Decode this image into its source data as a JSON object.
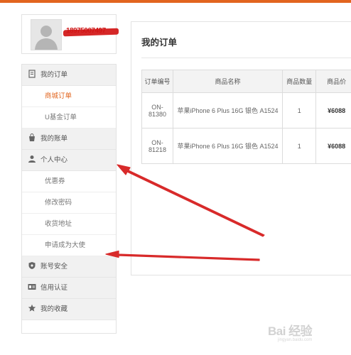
{
  "user": {
    "name": "18975007497"
  },
  "sidebar": {
    "items": [
      {
        "type": "group",
        "label": "我的订单",
        "icon": "document-icon"
      },
      {
        "type": "item",
        "label": "商城订单",
        "active": true
      },
      {
        "type": "item",
        "label": "U基金订单"
      },
      {
        "type": "group",
        "label": "我的账单",
        "icon": "bag-icon"
      },
      {
        "type": "group",
        "label": "个人中心",
        "icon": "person-icon"
      },
      {
        "type": "item",
        "label": "优惠券"
      },
      {
        "type": "item",
        "label": "修改密码"
      },
      {
        "type": "item",
        "label": "收货地址"
      },
      {
        "type": "item",
        "label": "申请成为大使"
      },
      {
        "type": "group",
        "label": "账号安全",
        "icon": "shield-icon"
      },
      {
        "type": "group",
        "label": "信用认证",
        "icon": "id-card-icon"
      },
      {
        "type": "group",
        "label": "我的收藏",
        "icon": "star-icon"
      }
    ]
  },
  "main": {
    "title": "我的订单",
    "table": {
      "headers": [
        "订单编号",
        "商品名称",
        "商品数量",
        "商品价"
      ],
      "rows": [
        {
          "order_id_1": "ON-",
          "order_id_2": "81380",
          "name": "苹果iPhone 6 Plus 16G 银色 A1524",
          "qty": "1",
          "price": "¥6088"
        },
        {
          "order_id_1": "ON-",
          "order_id_2": "81218",
          "name": "苹果iPhone 6 Plus 16G 银色 A1524",
          "qty": "1",
          "price": "¥6088"
        }
      ]
    }
  },
  "watermark": {
    "text": "Bai 经验",
    "sub": "jingyan.baidu.com"
  },
  "colors": {
    "accent": "#e2651f",
    "arrow": "#d82a2a",
    "redaction": "#d11515"
  }
}
